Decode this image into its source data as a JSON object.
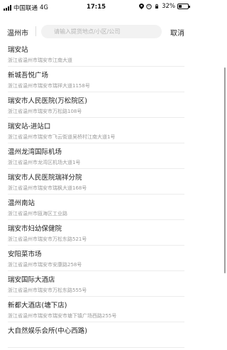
{
  "status_bar": {
    "carrier": "中国联通",
    "network": "4G",
    "time": "17:15",
    "battery": "32%",
    "battery_level": 0.32
  },
  "search": {
    "city": "温州市",
    "placeholder": "请输入提货地点/小区/公司",
    "cancel_label": "取消"
  },
  "results": [
    {
      "name": "瑞安站",
      "address": "浙江省温州市瑞安市江南大道"
    },
    {
      "name": "新城吾悦广场",
      "address": "浙江省温州市瑞安市瑞祥大道1158号"
    },
    {
      "name": "瑞安市人民医院(万松院区)",
      "address": "浙江省温州市瑞安市万松路108号"
    },
    {
      "name": "瑞安站-进站口",
      "address": "浙江省温州市瑞安市飞云街道吴桥村江南大道1号"
    },
    {
      "name": "温州龙湾国际机场",
      "address": "浙江省温州市龙湾区机场大道1号"
    },
    {
      "name": "瑞安市人民医院瑞祥分院",
      "address": "浙江省温州市瑞安市瑞枫大道168号"
    },
    {
      "name": "温州南站",
      "address": "浙江省温州市瓯海区工业路"
    },
    {
      "name": "瑞安市妇幼保健院",
      "address": "浙江省温州市瑞安市万松东路521号"
    },
    {
      "name": "安阳菜市场",
      "address": "浙江省温州市瑞安市安康路258号"
    },
    {
      "name": "瑞安国际大酒店",
      "address": "浙江省温州市瑞安市万松东路555号"
    },
    {
      "name": "新都大酒店(塘下店)",
      "address": "浙江省温州市瑞安市瑞安市塘下镇广场西路255号"
    },
    {
      "name": "大自然娱乐会所(中心西路)",
      "address": ""
    }
  ]
}
